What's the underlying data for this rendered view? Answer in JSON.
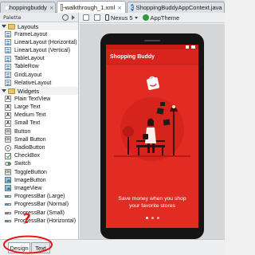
{
  "tabs": [
    {
      "label": "shoppingbuddy",
      "icon": "android-icon",
      "active": false
    },
    {
      "label": "walkthrough_1.xml",
      "icon": "xml-file-icon",
      "active": true
    },
    {
      "label": "ShoppingBuddyAppContext.java",
      "icon": "class-file-icon",
      "active": false
    }
  ],
  "palette": {
    "title": "Palette",
    "sections": [
      {
        "label": "Layouts",
        "items": [
          {
            "label": "FrameLayout",
            "icon": "layout-icon"
          },
          {
            "label": "LinearLayout (Horizontal)",
            "icon": "layout-icon"
          },
          {
            "label": "LinearLayout (Vertical)",
            "icon": "layout-icon"
          },
          {
            "label": "TableLayout",
            "icon": "layout-icon"
          },
          {
            "label": "TableRow",
            "icon": "layout-icon"
          },
          {
            "label": "GridLayout",
            "icon": "layout-icon"
          },
          {
            "label": "RelativeLayout",
            "icon": "layout-icon"
          }
        ]
      },
      {
        "label": "Widgets",
        "items": [
          {
            "label": "Plain TextView",
            "icon": "textview-icon"
          },
          {
            "label": "Large Text",
            "icon": "textview-icon"
          },
          {
            "label": "Medium Text",
            "icon": "textview-icon"
          },
          {
            "label": "Small Text",
            "icon": "textview-icon"
          },
          {
            "label": "Button",
            "icon": "button-icon"
          },
          {
            "label": "Small Button",
            "icon": "button-icon"
          },
          {
            "label": "RadioButton",
            "icon": "radio-icon"
          },
          {
            "label": "CheckBox",
            "icon": "checkbox-icon"
          },
          {
            "label": "Switch",
            "icon": "switch-icon"
          },
          {
            "label": "ToggleButton",
            "icon": "button-icon"
          },
          {
            "label": "ImageButton",
            "icon": "image-icon"
          },
          {
            "label": "ImageView",
            "icon": "image-icon"
          },
          {
            "label": "ProgressBar (Large)",
            "icon": "progressbar-icon"
          },
          {
            "label": "ProgressBar (Normal)",
            "icon": "progressbar-icon"
          },
          {
            "label": "ProgressBar (Small)",
            "icon": "progressbar-icon"
          },
          {
            "label": "ProgressBar (Horizontal)",
            "icon": "progressbar-icon"
          }
        ]
      }
    ]
  },
  "toolbar": {
    "device": "Nexus 5",
    "theme": "AppTheme"
  },
  "preview": {
    "app_title": "Shopping Buddy",
    "tagline_line1": "Save money when you shop",
    "tagline_line2": "your favorite stores",
    "pager_dots": 3,
    "active_dot": 0
  },
  "bottom_tabs": [
    {
      "label": "Design",
      "active": true
    },
    {
      "label": "Text",
      "active": false
    }
  ],
  "annotation": {
    "mark": "?",
    "color": "#e31818"
  },
  "colors": {
    "screen_red": "#e12b23",
    "appbar_red": "#d8241d",
    "annotation_red": "#e31818"
  }
}
